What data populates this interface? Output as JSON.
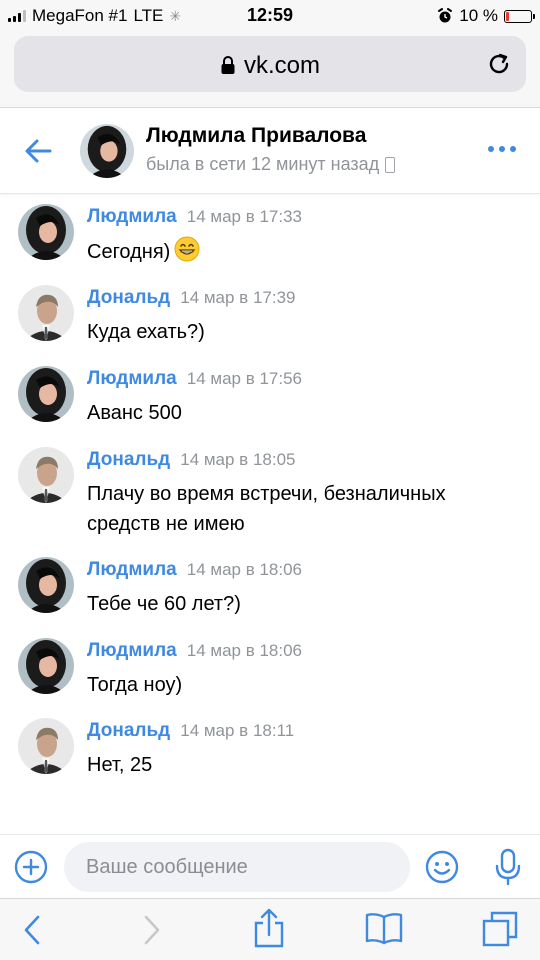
{
  "status_bar": {
    "carrier": "MegaFon #1",
    "network": "LTE",
    "time": "12:59",
    "battery_percent_label": "10 %",
    "battery_level": 0.1
  },
  "browser": {
    "url": "vk.com"
  },
  "chat_header": {
    "name": "Людмила Привалова",
    "status": "была в сети 12 минут назад"
  },
  "messages": [
    {
      "author": "Людмила",
      "time": "14 мар в 17:33",
      "text": "Сегодня)",
      "emoji": "grinning-face-icon",
      "avatar": "lyudmila-avatar"
    },
    {
      "author": "Дональд",
      "time": "14 мар в 17:39",
      "text": "Куда ехать?)",
      "avatar": "donald-avatar"
    },
    {
      "author": "Людмила",
      "time": "14 мар в 17:56",
      "text": "Аванс 500",
      "avatar": "lyudmila-avatar"
    },
    {
      "author": "Дональд",
      "time": "14 мар в 18:05",
      "text": "Плачу во время встречи, безналичных средств не имею",
      "avatar": "donald-avatar"
    },
    {
      "author": "Людмила",
      "time": "14 мар в 18:06",
      "text": "Тебе че 60 лет?)",
      "avatar": "lyudmila-avatar"
    },
    {
      "author": "Людмила",
      "time": "14 мар в 18:06",
      "text": "Тогда ноу)",
      "avatar": "lyudmila-avatar"
    },
    {
      "author": "Дональд",
      "time": "14 мар в 18:11",
      "text": "Нет, 25",
      "avatar": "donald-avatar"
    }
  ],
  "composer": {
    "placeholder": "Ваше сообщение",
    "value": ""
  },
  "colors": {
    "accent": "#3f8ae0",
    "meta_gray": "#909499",
    "battery_low": "#e53935"
  }
}
